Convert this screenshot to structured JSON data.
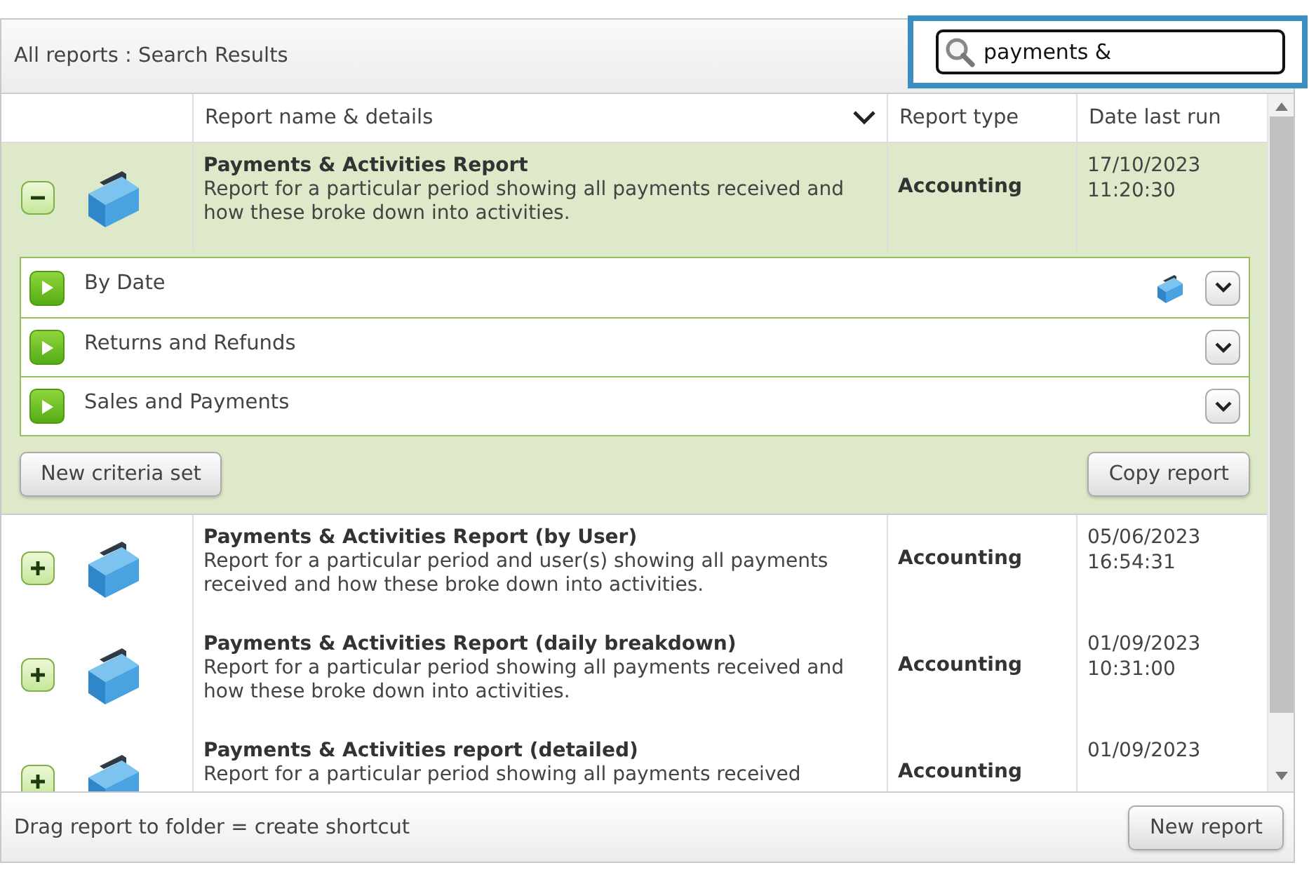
{
  "header": {
    "breadcrumb": "All reports : Search Results",
    "search": {
      "value": "payments &",
      "focused": true
    }
  },
  "table": {
    "columns": [
      "Report name & details",
      "Report type",
      "Date last run"
    ],
    "rows": [
      {
        "title": "Payments & Activities Report",
        "description": "Report for a particular period showing all payments received and how these broke down into activities.",
        "type": "Accounting",
        "date": "17/10/2023",
        "time": "11:20:30",
        "expanded": true,
        "criteria_sets": [
          {
            "label": "By Date",
            "shortcut": true
          },
          {
            "label": "Returns and Refunds",
            "shortcut": false
          },
          {
            "label": "Sales and Payments",
            "shortcut": false
          }
        ],
        "buttons": [
          "New criteria set",
          "Copy report"
        ]
      },
      {
        "title": "Payments & Activities Report (by User)",
        "description": "Report for a particular period and user(s) showing all payments received and how these broke down into activities.",
        "type": "Accounting",
        "date": "05/06/2023",
        "time": "16:54:31",
        "expanded": false
      },
      {
        "title": "Payments & Activities Report (daily breakdown)",
        "description": "Report for a particular period showing all payments received and how these broke down into activities.",
        "type": "Accounting",
        "date": "01/09/2023",
        "time": "10:31:00",
        "expanded": false
      },
      {
        "title": "Payments & Activities report (detailed)",
        "description": "Report for a particular period showing all payments received",
        "type": "Accounting",
        "date": "01/09/2023",
        "expanded": false
      }
    ]
  },
  "footer": {
    "hint": "Drag report to folder = create shortcut",
    "button": "New report"
  }
}
